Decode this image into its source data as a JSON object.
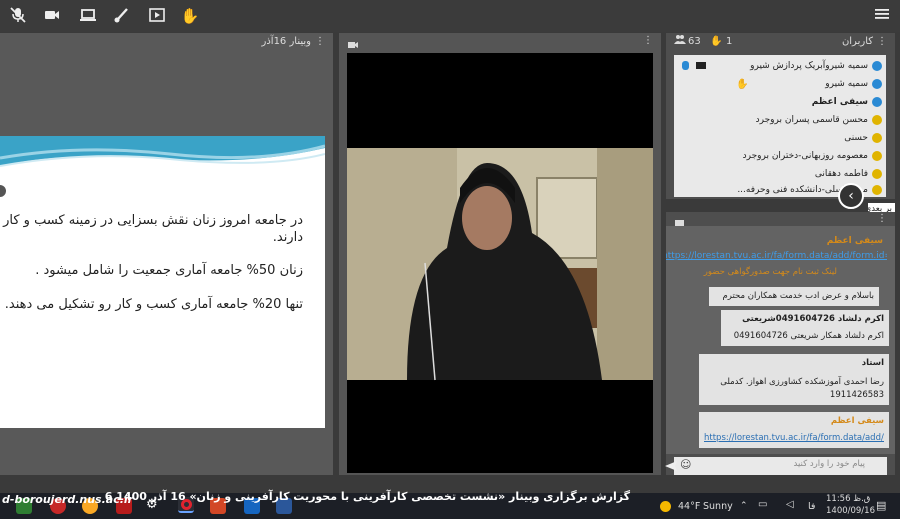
{
  "colors": {
    "accent_blue": "#2a8ad4",
    "accent_orange": "#d48a1a",
    "presenter_yellow": "#e0b400"
  },
  "slide_panel": {
    "title": "وبینار 16آذر"
  },
  "slide": {
    "lines": [
      "در جامعه امروز زنان نقش بسزایی در زمینه کسب و کار",
      "دارند.",
      "زنان 50% جامعه آماری جمعیت را شامل میشود .",
      "تنها 20% جامعه آماری کسب و کار رو تشکیل می دهند."
    ]
  },
  "users": {
    "title": "کاربران",
    "count": "63",
    "raised_hands": "1",
    "list": [
      {
        "name": "سمیه شیروآبریک پردازش شیرو"
      },
      {
        "name": "سمیه شیرو"
      },
      {
        "name": "سیفی اعظم"
      },
      {
        "name": "محسن قاسمی پسران بروجرد"
      },
      {
        "name": "حسنی"
      },
      {
        "name": "معصومه روزبهانی-دختران بروجرد"
      },
      {
        "name": "فاطمه دهقانی"
      },
      {
        "name": "...مدیر ناسلی-دانشکده فنی وحرفه"
      }
    ],
    "tooltip": "بر بعدی"
  },
  "chat": {
    "pinned_author": "سیفی اعظم",
    "pinned_link": "https://lorestan.tvu.ac.ir/fa/form.data/add/form.id=4607",
    "pinned_note": "لینک ثبت نام   جهت صدورگواهی حضور",
    "messages": [
      {
        "author": "",
        "text": "باسلام و عرض ادب خدمت همکاران محترم"
      },
      {
        "author": "اکرم دلشاد 0491604726شریعتی",
        "text": "اکرم دلشاد همکار شریعتی 0491604726"
      },
      {
        "author": "استاد",
        "text": "رضا احمدی آموزشکده کشاورزی اهواز. کدملی 1911426583"
      },
      {
        "author": "سیفی اعظم",
        "text": "https://lorestan.tvu.ac.ir/fa/form.data/add/for"
      }
    ],
    "input_placeholder": "پیام خود را وارد کنید"
  },
  "taskbar": {
    "caption": "گزارش برگزاری وبینار «نشست تخصصی کارآفرینی با محوریت کارآفرینی و زنان» 16 آذر 1400 6",
    "site": "d-boroujerd.nus.ac.ir",
    "weather_temp": "44°F",
    "weather_desc": "Sunny",
    "lang": "فا",
    "time": "11:56 ق.ظ",
    "date": "1400/09/16"
  }
}
